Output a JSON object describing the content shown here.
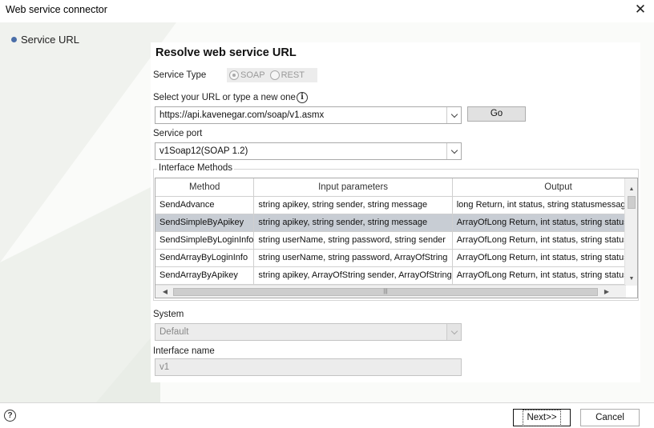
{
  "window": {
    "title": "Web service connector"
  },
  "nav": {
    "items": [
      {
        "label": "Service URL"
      }
    ]
  },
  "heading": "Resolve web service URL",
  "service_type": {
    "label": "Service Type",
    "options": [
      {
        "label": "SOAP",
        "selected": true
      },
      {
        "label": "REST",
        "selected": false
      }
    ]
  },
  "url": {
    "label": "Select your URL or type a new one",
    "value": "https://api.kavenegar.com/soap/v1.asmx",
    "go_label": "Go"
  },
  "service_port": {
    "label": "Service port",
    "value": "v1Soap12(SOAP 1.2)"
  },
  "interface_methods": {
    "title": "Interface Methods",
    "columns": [
      "Method",
      "Input parameters",
      "Output"
    ],
    "rows": [
      {
        "method": "SendAdvance",
        "input": "string apikey, string sender, string message",
        "output": "long Return, int status, string statusmessage"
      },
      {
        "method": "SendSimpleByApikey",
        "input": "string apikey, string sender, string message",
        "output": "ArrayOfLong Return, int status, string statusmessage",
        "selected": true
      },
      {
        "method": "SendSimpleByLoginInfo",
        "input": "string userName, string password, string sender",
        "output": "ArrayOfLong Return, int status, string statusmessage"
      },
      {
        "method": "SendArrayByLoginInfo",
        "input": "string userName, string password, ArrayOfString",
        "output": "ArrayOfLong Return, int status, string statusmessage"
      },
      {
        "method": "SendArrayByApikey",
        "input": "string apikey, ArrayOfString sender, ArrayOfString",
        "output": "ArrayOfLong Return, int status, string statusmessage"
      }
    ]
  },
  "system": {
    "label": "System",
    "value": "Default"
  },
  "interface_name": {
    "label": "Interface name",
    "value": "v1"
  },
  "footer": {
    "help_label": "?",
    "next_label": "Next>>",
    "cancel_label": "Cancel"
  },
  "colors": {
    "selected_row": "#c8cdd4",
    "nav_bullet": "#4a6ea8"
  }
}
